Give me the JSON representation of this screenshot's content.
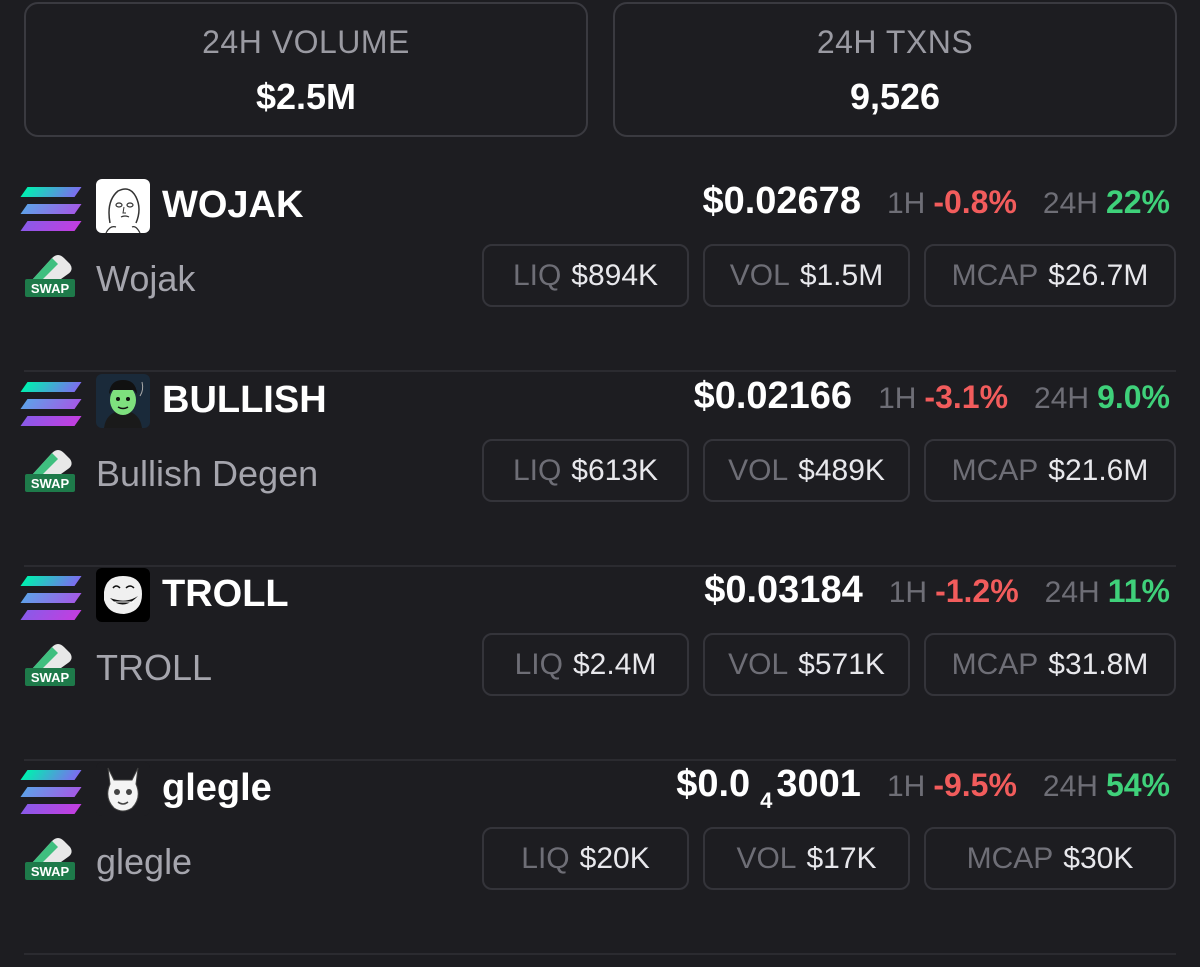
{
  "stats": {
    "volume_label": "24H VOLUME",
    "volume_value": "$2.5M",
    "txns_label": "24H TXNS",
    "txns_value": "9,526"
  },
  "colors": {
    "background": "#1d1d21",
    "negative": "#f25c5c",
    "positive": "#3fd17a",
    "muted": "#6e6e76"
  },
  "tokens": [
    {
      "symbol": "WOJAK",
      "name": "Wojak",
      "price": "$0.02678",
      "h1_label": "1H",
      "h1": "-0.8%",
      "h24_label": "24H",
      "h24": "22%",
      "liq_label": "LIQ",
      "liq": "$894K",
      "vol_label": "VOL",
      "vol": "$1.5M",
      "mcap_label": "MCAP",
      "mcap": "$26.7M",
      "icon": "wojak-avatar-icon"
    },
    {
      "symbol": "BULLISH",
      "name": "Bullish Degen",
      "price": "$0.02166",
      "h1_label": "1H",
      "h1": "-3.1%",
      "h24_label": "24H",
      "h24": "9.0%",
      "liq_label": "LIQ",
      "liq": "$613K",
      "vol_label": "VOL",
      "vol": "$489K",
      "mcap_label": "MCAP",
      "mcap": "$21.6M",
      "icon": "bullish-avatar-icon"
    },
    {
      "symbol": "TROLL",
      "name": "TROLL",
      "price": "$0.03184",
      "h1_label": "1H",
      "h1": "-1.2%",
      "h24_label": "24H",
      "h24": "11%",
      "liq_label": "LIQ",
      "liq": "$2.4M",
      "vol_label": "VOL",
      "vol": "$571K",
      "mcap_label": "MCAP",
      "mcap": "$31.8M",
      "icon": "troll-avatar-icon"
    },
    {
      "symbol": "glegle",
      "name": "glegle",
      "price_main": "$0.0",
      "price_sub": "4",
      "price_tail": "3001",
      "h1_label": "1H",
      "h1": "-9.5%",
      "h24_label": "24H",
      "h24": "54%",
      "liq_label": "LIQ",
      "liq": "$20K",
      "vol_label": "VOL",
      "vol": "$17K",
      "mcap_label": "MCAP",
      "mcap": "$30K",
      "icon": "glegle-avatar-icon"
    }
  ],
  "swap_badge": "SWAP"
}
